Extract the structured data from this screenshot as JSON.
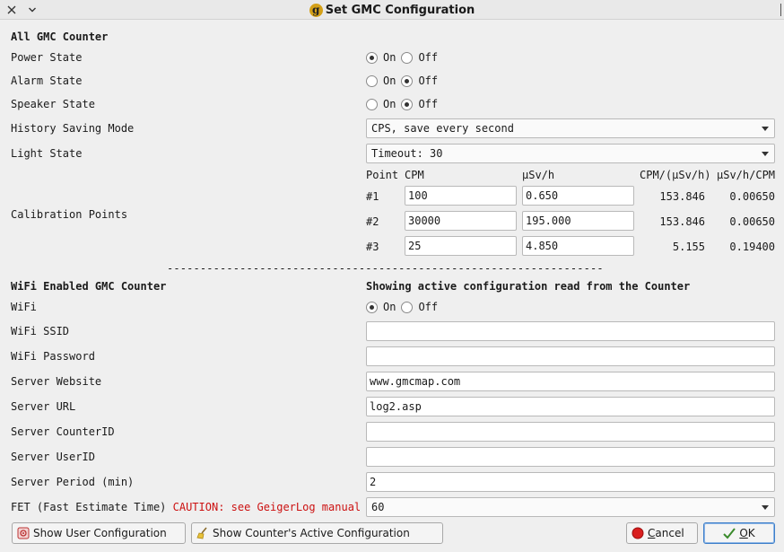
{
  "window": {
    "title": "Set GMC Configuration",
    "logo_letter": "g"
  },
  "section_all": {
    "heading": "All GMC Counter",
    "power": {
      "label": "Power State",
      "on_label": "On",
      "off_label": "Off",
      "value": "On"
    },
    "alarm": {
      "label": "Alarm State",
      "on_label": "On",
      "off_label": "Off",
      "value": "Off"
    },
    "speaker": {
      "label": "Speaker State",
      "on_label": "On",
      "off_label": "Off",
      "value": "Off"
    },
    "history": {
      "label": "History Saving Mode",
      "selected": "CPS, save every second"
    },
    "light": {
      "label": "Light State",
      "selected": "Timeout: 30"
    },
    "calibration": {
      "label": "Calibration Points",
      "headers": [
        "Point",
        "CPM",
        "µSv/h",
        "CPM/(µSv/h)",
        "µSv/h/CPM"
      ],
      "rows": [
        {
          "point": "#1",
          "cpm": "100",
          "usvh": "0.650",
          "factor": "153.846",
          "inverse": "0.00650"
        },
        {
          "point": "#2",
          "cpm": "30000",
          "usvh": "195.000",
          "factor": "153.846",
          "inverse": "0.00650"
        },
        {
          "point": "#3",
          "cpm": "25",
          "usvh": "4.850",
          "factor": "5.155",
          "inverse": "0.19400"
        }
      ]
    }
  },
  "divider": "------------------------------------------------------------------",
  "section_wifi": {
    "heading": "WiFi Enabled GMC Counter",
    "info": "Showing active configuration read from the Counter",
    "wifi": {
      "label": "WiFi",
      "on_label": "On",
      "off_label": "Off",
      "value": "On"
    },
    "ssid": {
      "label": "WiFi SSID",
      "value": ""
    },
    "password": {
      "label": "WiFi Password",
      "value": ""
    },
    "website": {
      "label": "Server Website",
      "value": "www.gmcmap.com"
    },
    "url": {
      "label": "Server URL",
      "value": "log2.asp"
    },
    "counter_id": {
      "label": "Server CounterID",
      "value": ""
    },
    "user_id": {
      "label": "Server UserID",
      "value": ""
    },
    "period": {
      "label": "Server Period (min)",
      "value": "2"
    },
    "fet": {
      "label": "FET (Fast Estimate Time)",
      "caution": "CAUTION: see GeigerLog manual",
      "selected": "60"
    }
  },
  "buttons": {
    "show_user": "Show User Configuration",
    "show_active": "Show Counter's Active Configuration",
    "cancel_prefix": "",
    "cancel_mnemonic": "C",
    "cancel_rest": "ancel",
    "ok_mnemonic": "O",
    "ok_rest": "K"
  },
  "colors": {
    "caution": "#cc1111",
    "accent": "#3d7ec9"
  }
}
